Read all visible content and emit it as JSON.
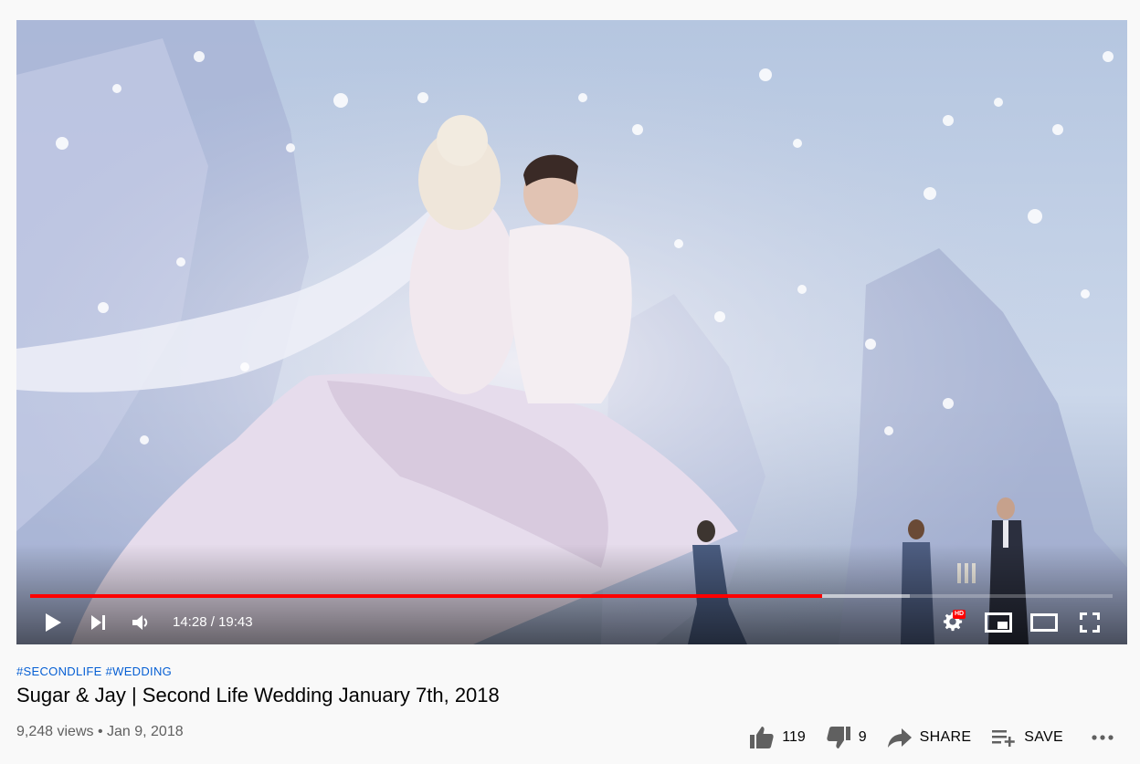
{
  "video": {
    "current_time": "14:28",
    "duration": "19:43",
    "played_fraction": 0.732,
    "buffered_fraction": 0.813,
    "hd_badge": "HD"
  },
  "hashtags": [
    "#SECONDLIFE",
    "#WEDDING"
  ],
  "title": "Sugar & Jay | Second Life Wedding January 7th, 2018",
  "views": "9,248 views",
  "date": "Jan 9, 2018",
  "actions": {
    "likes": "119",
    "dislikes": "9",
    "share": "SHARE",
    "save": "SAVE"
  },
  "colors": {
    "progress_played": "#ff0000",
    "hashtag_link": "#065fd4"
  }
}
